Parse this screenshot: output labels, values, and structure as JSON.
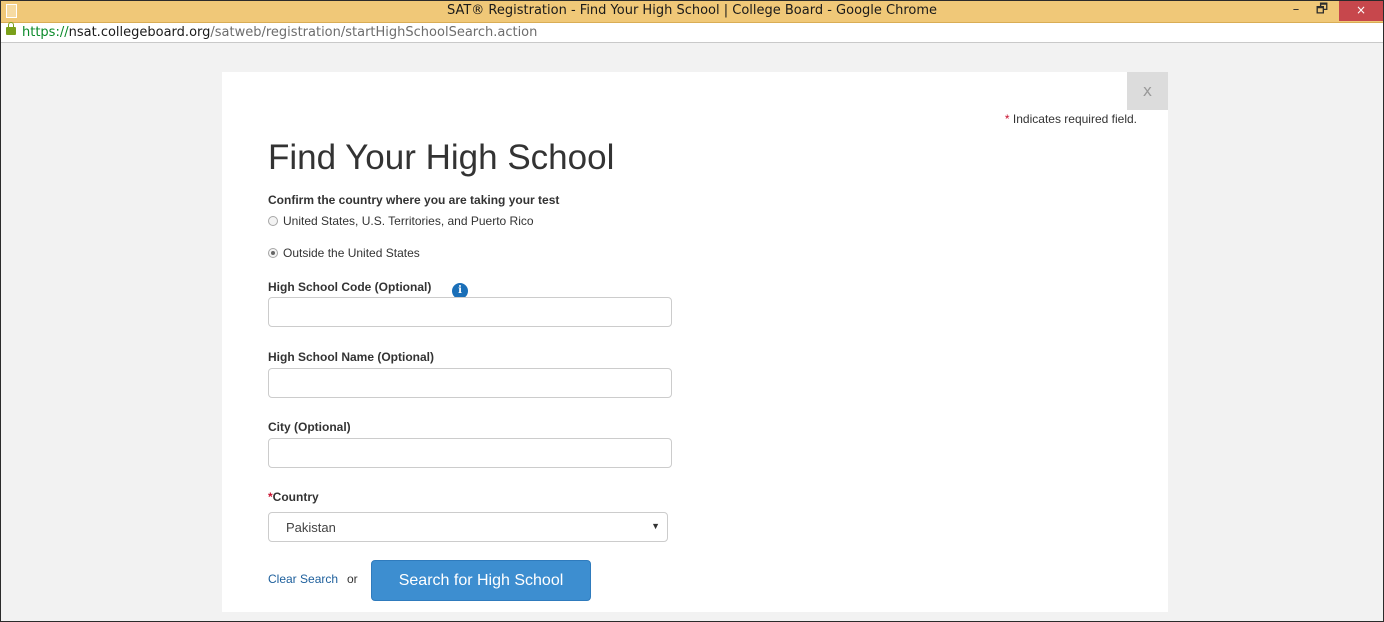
{
  "window": {
    "title": "SAT® Registration - Find Your High School | College Board - Google Chrome",
    "controls": {
      "minimize": "–",
      "restore": "🗗",
      "close": "×"
    }
  },
  "address_bar": {
    "scheme": "https://",
    "host": "nsat.collegeboard.org",
    "path": "/satweb/registration/startHighSchoolSearch.action"
  },
  "modal": {
    "close_label": "x",
    "required_note_star": "*",
    "required_note_text": " Indicates required field.",
    "heading": "Find Your High School",
    "country_question": "Confirm the country where you are taking your test",
    "radio_options": [
      {
        "label": "United States, U.S. Territories, and Puerto Rico",
        "checked": false
      },
      {
        "label": "Outside the United States",
        "checked": true
      }
    ],
    "fields": {
      "code_label": "High School Code (Optional)",
      "code_value": "",
      "info_icon_glyph": "i",
      "name_label": "High School Name (Optional)",
      "name_value": "",
      "city_label": "City (Optional)",
      "city_value": "",
      "country_required_star": "*",
      "country_label": "Country",
      "country_selected": "Pakistan",
      "dropdown_glyph": "▼"
    },
    "actions": {
      "clear_label": "Clear Search",
      "or_text": "or",
      "search_label": "Search for High School"
    }
  },
  "colors": {
    "titlebar": "#f0c878",
    "close_button": "#c7474c",
    "primary_button": "#3d8ed0",
    "link": "#1d5f9c",
    "required_star": "#c8102e",
    "info_icon": "#1a6fb8"
  },
  "icons": {
    "page": "page-icon",
    "lock": "lock-icon",
    "info": "info-icon",
    "dropdown": "chevron-down-icon",
    "close": "close-icon"
  }
}
